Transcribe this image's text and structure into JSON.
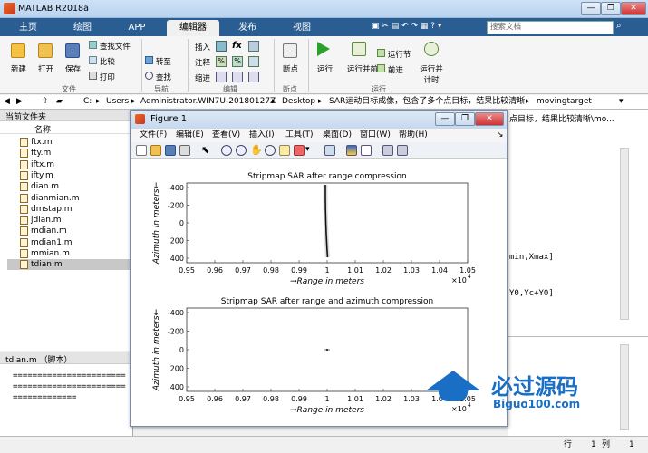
{
  "window": {
    "title": "MATLAB R2018a",
    "minimize": "—",
    "restore": "❐",
    "close": "✕"
  },
  "tabs": [
    "主页",
    "绘图",
    "APP",
    "编辑器",
    "发布",
    "视图"
  ],
  "search": {
    "placeholder": "搜索文档"
  },
  "ribbon": {
    "file_group": {
      "new": "新建",
      "open": "打开",
      "save": "保存",
      "find_files": "查找文件",
      "compare": "比较",
      "print": "打印",
      "label": "文件"
    },
    "nav_group": {
      "goto": "转至",
      "find": "查找",
      "label": "导航"
    },
    "edit_group": {
      "insert": "插入",
      "comment": "注释",
      "indent": "缩进",
      "fx": "fx",
      "label": "编辑"
    },
    "breakpoint_group": {
      "breakpoint": "断点",
      "label": "断点"
    },
    "run_group": {
      "run": "运行",
      "run_advance": "运行并前进",
      "run_section": "运行节",
      "advance": "前进",
      "run_time": "运行并计时",
      "label": "运行"
    }
  },
  "address": {
    "parts": [
      "C:",
      "Users",
      "Administrator.WIN7U-20180127Z",
      "Desktop",
      "SAR运动目标成像，包含了多个点目标，结果比较清晰",
      "movingtarget"
    ]
  },
  "current_folder": {
    "title": "当前文件夹",
    "column": "名称",
    "files": [
      "ftx.m",
      "fty.m",
      "iftx.m",
      "ifty.m",
      "dian.m",
      "dianmian.m",
      "dmstap.m",
      "jdian.m",
      "mdian.m",
      "mdian1.m",
      "mmian.m",
      "tdian.m"
    ],
    "selected": "tdian.m"
  },
  "details": {
    "title": "tdian.m （脚本）",
    "lines": [
      "=======================",
      "=======================",
      "============="
    ]
  },
  "editor_fragments": [
    "点目标，结果比较清晰\\mo...",
    "min,Xmax]",
    "Y0,Yc+Y0]"
  ],
  "status": {
    "row_label": "行",
    "row": "1",
    "col_label": "列",
    "col": "1"
  },
  "figure": {
    "title": "Figure 1",
    "menu": [
      "文件(F)",
      "编辑(E)",
      "查看(V)",
      "插入(I)",
      "工具(T)",
      "桌面(D)",
      "窗口(W)",
      "帮助(H)"
    ],
    "plots": [
      {
        "title": "Stripmap SAR after range compression",
        "xlabel": "→Range in meters",
        "ylabel": "Azimuth in meters←",
        "xticks": [
          "0.95",
          "0.96",
          "0.97",
          "0.98",
          "0.99",
          "1",
          "1.01",
          "1.02",
          "1.03",
          "1.04",
          "1.05"
        ],
        "yticks": [
          "-400",
          "-200",
          "0",
          "200",
          "400"
        ],
        "exponent": "×10",
        "exp_power": "4"
      },
      {
        "title": "Stripmap SAR after range and azimuth compression",
        "xlabel": "→Range in meters",
        "ylabel": "Azimuth in meters←",
        "xticks": [
          "0.95",
          "0.96",
          "0.97",
          "0.98",
          "0.99",
          "1",
          "1.01",
          "1.02",
          "1.03",
          "1.04",
          "1.05"
        ],
        "yticks": [
          "-400",
          "-200",
          "0",
          "200",
          "400"
        ],
        "exponent": "×10",
        "exp_power": "4"
      }
    ]
  },
  "watermark": {
    "title": "必过源码",
    "url": "Biguo100.com"
  },
  "colors": {
    "tabbar": "#2a5d91",
    "accent": "#1a6fc4",
    "watermark": "#1a6fc4"
  }
}
